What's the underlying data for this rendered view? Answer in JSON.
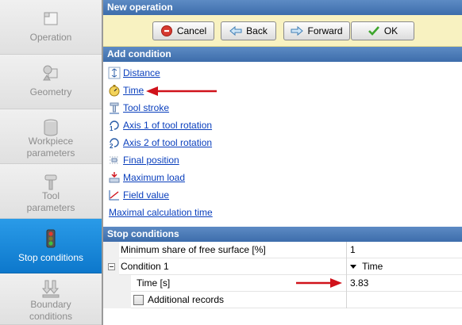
{
  "sidebar": {
    "items": [
      {
        "label_lines": [
          "Operation"
        ],
        "icon": "operation-icon",
        "active": false
      },
      {
        "label_lines": [
          "Geometry"
        ],
        "icon": "geometry-icon",
        "active": false
      },
      {
        "label_lines": [
          "Workpiece",
          "parameters"
        ],
        "icon": "workpiece-icon",
        "active": false
      },
      {
        "label_lines": [
          "Tool",
          "parameters"
        ],
        "icon": "tool-icon",
        "active": false
      },
      {
        "label_lines": [
          "Stop conditions"
        ],
        "icon": "traffic-light-icon",
        "active": true
      },
      {
        "label_lines": [
          "Boundary",
          "conditions"
        ],
        "icon": "boundary-icon",
        "active": false
      }
    ]
  },
  "header": {
    "title": "New operation"
  },
  "toolbar": {
    "cancel_label": "Cancel",
    "back_label": "Back",
    "forward_label": "Forward",
    "ok_label": "OK"
  },
  "add_condition": {
    "title": "Add condition",
    "items": [
      {
        "label": "Distance",
        "icon": "distance-icon"
      },
      {
        "label": "Time",
        "icon": "stopwatch-icon"
      },
      {
        "label": "Tool stroke",
        "icon": "tool-stroke-icon"
      },
      {
        "label": "Axis 1 of tool rotation",
        "icon": "axis1-rotation-icon"
      },
      {
        "label": "Axis 2 of tool rotation",
        "icon": "axis2-rotation-icon"
      },
      {
        "label": "Final position",
        "icon": "final-position-icon"
      },
      {
        "label": "Maximum load",
        "icon": "maximum-load-icon"
      },
      {
        "label": "Field value",
        "icon": "field-value-icon"
      }
    ],
    "max_calc_time_label": "Maximal calculation time"
  },
  "stop_conditions": {
    "title": "Stop conditions",
    "min_share_label": "Minimum share of free surface [%]",
    "min_share_value": "1",
    "condition1_label": "Condition 1",
    "condition1_type": "Time",
    "time_label": "Time [s]",
    "time_value": "3.83",
    "additional_records_label": "Additional records",
    "additional_records_checked": false
  },
  "colors": {
    "accent_blue": "#0d78cc",
    "header_blue": "#4a7bb8",
    "toolbar_yellow": "#f8f2c1",
    "link_blue": "#0a3fbd",
    "arrow_red": "#d0121b"
  }
}
